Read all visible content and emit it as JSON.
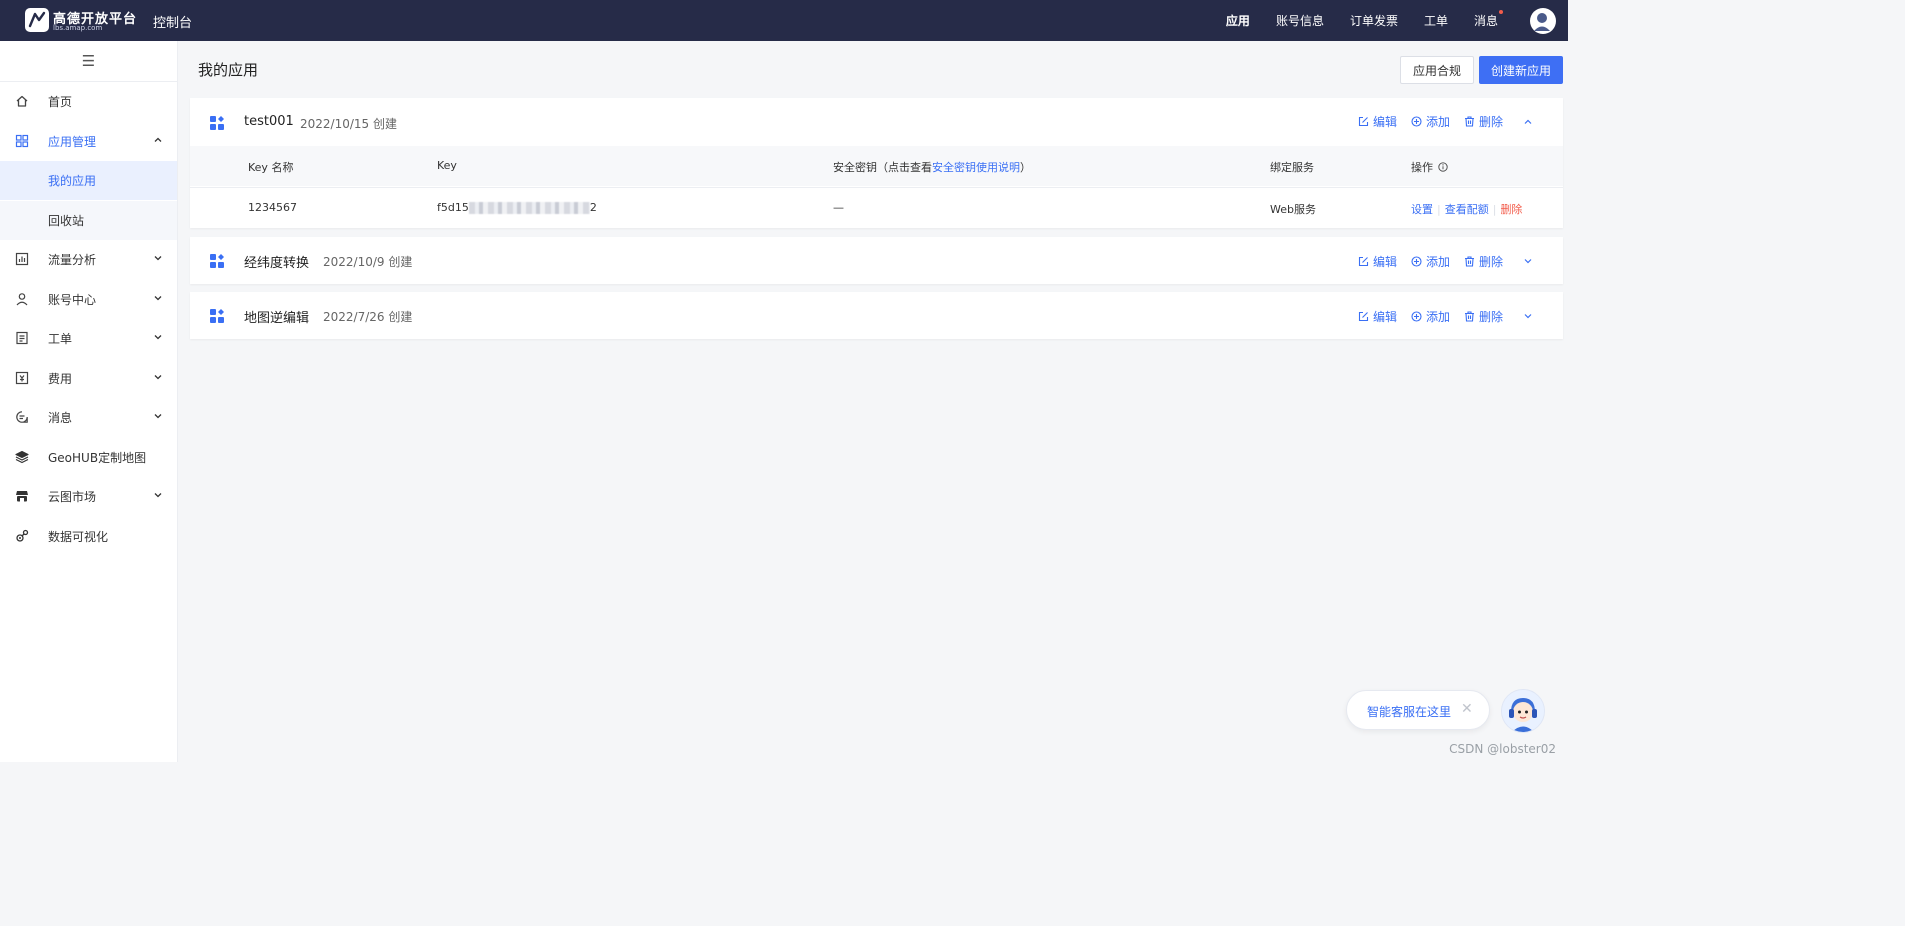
{
  "topbar": {
    "logo_text": "高德开放平台",
    "logo_url": "lbs.amap.com",
    "console_title": "控制台",
    "nav": [
      "应用",
      "账号信息",
      "订单发票",
      "工单",
      "消息"
    ]
  },
  "sidebar": {
    "items": [
      {
        "label": "首页",
        "icon": "home-icon"
      },
      {
        "label": "应用管理",
        "icon": "grid-icon"
      },
      {
        "label": "我的应用"
      },
      {
        "label": "回收站"
      },
      {
        "label": "流量分析",
        "icon": "chart-icon"
      },
      {
        "label": "账号中心",
        "icon": "user-icon"
      },
      {
        "label": "工单",
        "icon": "ticket-icon"
      },
      {
        "label": "费用",
        "icon": "bill-icon"
      },
      {
        "label": "消息",
        "icon": "message-icon"
      },
      {
        "label": "GeoHUB定制地图",
        "icon": "layers-icon"
      },
      {
        "label": "云图市场",
        "icon": "store-icon"
      },
      {
        "label": "数据可视化",
        "icon": "visual-icon"
      }
    ]
  },
  "main": {
    "title": "我的应用",
    "compliance_button": "应用合规",
    "create_button": "创建新应用",
    "actions": {
      "edit": "编辑",
      "add": "添加",
      "delete": "删除"
    },
    "table": {
      "headers": [
        "Key 名称",
        "Key",
        "安全密钥（点击查看",
        "安全密钥使用说明",
        "）",
        "绑定服务",
        "操作"
      ],
      "row": {
        "key_name": "1234567",
        "key_prefix": "f5d15",
        "key_suffix": "2",
        "secret": "—",
        "service": "Web服务",
        "ops": {
          "settings": "设置",
          "quota": "查看配额",
          "delete": "删除"
        }
      }
    },
    "apps": [
      {
        "name": "test001",
        "date": "2022/10/15 创建"
      },
      {
        "name": "经纬度转换",
        "date": "2022/10/9 创建"
      },
      {
        "name": "地图逆编辑",
        "date": "2022/7/26 创建"
      }
    ]
  },
  "chat": {
    "text": "智能客服在这里",
    "close": "✕"
  },
  "watermark": "CSDN @lobster02",
  "colors": {
    "topbar": "#262b48",
    "primary": "#3e6ff4",
    "danger": "#f25c4b"
  }
}
